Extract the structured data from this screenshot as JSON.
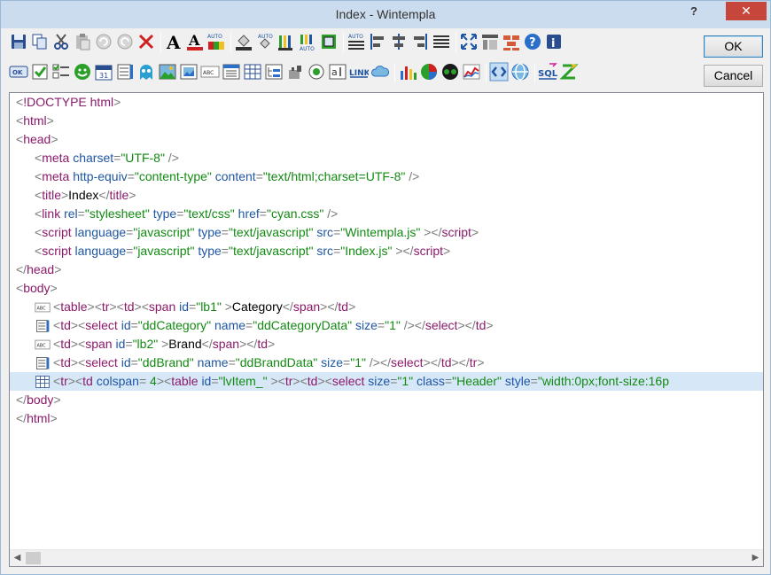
{
  "window": {
    "title": "Index  -  Wintempla",
    "help_glyph": "?",
    "close_glyph": "✕"
  },
  "buttons": {
    "ok": "OK",
    "cancel": "Cancel"
  },
  "toolbar": {
    "row1": [
      {
        "name": "save-icon",
        "glyph": "save"
      },
      {
        "name": "copy-icon",
        "glyph": "copy"
      },
      {
        "name": "cut-icon",
        "glyph": "cut"
      },
      {
        "name": "paste-icon",
        "glyph": "paste"
      },
      {
        "name": "undo-icon",
        "glyph": "undo"
      },
      {
        "name": "redo-icon",
        "glyph": "redo"
      },
      {
        "name": "delete-icon",
        "glyph": "delete"
      },
      {
        "name": "sep"
      },
      {
        "name": "font-icon",
        "glyph": "font"
      },
      {
        "name": "font-color-icon",
        "glyph": "fontcolor"
      },
      {
        "name": "auto-color-icon",
        "glyph": "autocolor"
      },
      {
        "name": "sep"
      },
      {
        "name": "fill-bucket-icon",
        "glyph": "bucket"
      },
      {
        "name": "auto-fill-icon",
        "glyph": "autobucket"
      },
      {
        "name": "pencils-icon",
        "glyph": "pencils"
      },
      {
        "name": "auto-pencils-icon",
        "glyph": "autopencils"
      },
      {
        "name": "border-icon",
        "glyph": "border"
      },
      {
        "name": "sep"
      },
      {
        "name": "auto-align-icon",
        "glyph": "autoalign"
      },
      {
        "name": "align-left-icon",
        "glyph": "alignleft"
      },
      {
        "name": "align-center-icon",
        "glyph": "aligncenter"
      },
      {
        "name": "align-right-icon",
        "glyph": "alignright"
      },
      {
        "name": "justify-icon",
        "glyph": "justify"
      },
      {
        "name": "sep"
      },
      {
        "name": "fullscreen-icon",
        "glyph": "fullscreen"
      },
      {
        "name": "layout-icon",
        "glyph": "layout"
      },
      {
        "name": "bricks-icon",
        "glyph": "bricks"
      },
      {
        "name": "help-icon",
        "glyph": "help"
      },
      {
        "name": "info-icon",
        "glyph": "info"
      }
    ],
    "row2": [
      {
        "name": "ok-control-icon",
        "glyph": "okbtn"
      },
      {
        "name": "checkbox-icon",
        "glyph": "checkbox"
      },
      {
        "name": "checklist-icon",
        "glyph": "checklist"
      },
      {
        "name": "smiley-icon",
        "glyph": "smiley"
      },
      {
        "name": "calendar-icon",
        "glyph": "calendar"
      },
      {
        "name": "listbox-icon",
        "glyph": "listbox"
      },
      {
        "name": "ghost-icon",
        "glyph": "ghost"
      },
      {
        "name": "picture-icon",
        "glyph": "picture"
      },
      {
        "name": "image-frame-icon",
        "glyph": "imageframe"
      },
      {
        "name": "label-icon",
        "glyph": "label"
      },
      {
        "name": "listview-icon",
        "glyph": "listview"
      },
      {
        "name": "table-icon",
        "glyph": "table"
      },
      {
        "name": "tree-icon",
        "glyph": "tree"
      },
      {
        "name": "plugin-icon",
        "glyph": "plugin"
      },
      {
        "name": "radio-icon",
        "glyph": "radio"
      },
      {
        "name": "textbox-icon",
        "glyph": "textbox"
      },
      {
        "name": "link-icon",
        "glyph": "link",
        "text": "LINK"
      },
      {
        "name": "cloud-icon",
        "glyph": "cloud"
      },
      {
        "name": "sep"
      },
      {
        "name": "bar-chart-icon",
        "glyph": "barchart"
      },
      {
        "name": "pie-chart-icon",
        "glyph": "piechart"
      },
      {
        "name": "eyes-icon",
        "glyph": "eyes"
      },
      {
        "name": "line-chart-icon",
        "glyph": "linechart"
      },
      {
        "name": "sep"
      },
      {
        "name": "code-view-icon",
        "glyph": "code"
      },
      {
        "name": "browser-view-icon",
        "glyph": "browser"
      },
      {
        "name": "sep"
      },
      {
        "name": "sql-icon",
        "glyph": "sql",
        "text": "SQL"
      },
      {
        "name": "sort-icon",
        "glyph": "sort"
      }
    ]
  },
  "editor": {
    "lines": [
      {
        "indent": 0,
        "icon": null,
        "tokens": [
          [
            "br",
            "<"
          ],
          [
            "tag",
            "!DOCTYPE html"
          ],
          [
            "br",
            ">"
          ]
        ]
      },
      {
        "indent": 0,
        "icon": null,
        "tokens": [
          [
            "br",
            "<"
          ],
          [
            "tag",
            "html"
          ],
          [
            "br",
            ">"
          ]
        ]
      },
      {
        "indent": 0,
        "icon": null,
        "tokens": [
          [
            "br",
            "<"
          ],
          [
            "tag",
            "head"
          ],
          [
            "br",
            ">"
          ]
        ]
      },
      {
        "indent": 1,
        "icon": null,
        "tokens": [
          [
            "br",
            "<"
          ],
          [
            "tag",
            "meta "
          ],
          [
            "attr",
            "charset"
          ],
          [
            "br",
            "="
          ],
          [
            "val",
            "\"UTF-8\""
          ],
          [
            "br",
            " />"
          ]
        ]
      },
      {
        "indent": 1,
        "icon": null,
        "tokens": [
          [
            "br",
            "<"
          ],
          [
            "tag",
            "meta "
          ],
          [
            "attr",
            "http-equiv"
          ],
          [
            "br",
            "="
          ],
          [
            "val",
            "\"content-type\""
          ],
          [
            "br",
            "  "
          ],
          [
            "attr",
            "content"
          ],
          [
            "br",
            "="
          ],
          [
            "val",
            "\"text/html;charset=UTF-8\""
          ],
          [
            "br",
            " />"
          ]
        ]
      },
      {
        "indent": 1,
        "icon": null,
        "tokens": [
          [
            "br",
            "<"
          ],
          [
            "tag",
            "title"
          ],
          [
            "br",
            ">"
          ],
          [
            "txt",
            "Index"
          ],
          [
            "br",
            "</"
          ],
          [
            "tag",
            "title"
          ],
          [
            "br",
            ">"
          ]
        ]
      },
      {
        "indent": 1,
        "icon": null,
        "tokens": [
          [
            "br",
            "<"
          ],
          [
            "tag",
            "link "
          ],
          [
            "attr",
            "rel"
          ],
          [
            "br",
            "="
          ],
          [
            "val",
            "\"stylesheet\""
          ],
          [
            "br",
            "  "
          ],
          [
            "attr",
            "type"
          ],
          [
            "br",
            "="
          ],
          [
            "val",
            "\"text/css\""
          ],
          [
            "br",
            "  "
          ],
          [
            "attr",
            "href"
          ],
          [
            "br",
            "="
          ],
          [
            "val",
            "\"cyan.css\""
          ],
          [
            "br",
            " />"
          ]
        ]
      },
      {
        "indent": 1,
        "icon": null,
        "tokens": [
          [
            "br",
            "<"
          ],
          [
            "tag",
            "script "
          ],
          [
            "attr",
            "language"
          ],
          [
            "br",
            "="
          ],
          [
            "val",
            "\"javascript\""
          ],
          [
            "br",
            "  "
          ],
          [
            "attr",
            "type"
          ],
          [
            "br",
            "="
          ],
          [
            "val",
            "\"text/javascript\""
          ],
          [
            "br",
            "  "
          ],
          [
            "attr",
            "src"
          ],
          [
            "br",
            "="
          ],
          [
            "val",
            "\"Wintempla.js\""
          ],
          [
            "br",
            " ></"
          ],
          [
            "tag",
            "script"
          ],
          [
            "br",
            ">"
          ]
        ]
      },
      {
        "indent": 1,
        "icon": null,
        "tokens": [
          [
            "br",
            "<"
          ],
          [
            "tag",
            "script "
          ],
          [
            "attr",
            "language"
          ],
          [
            "br",
            "="
          ],
          [
            "val",
            "\"javascript\""
          ],
          [
            "br",
            "  "
          ],
          [
            "attr",
            "type"
          ],
          [
            "br",
            "="
          ],
          [
            "val",
            "\"text/javascript\""
          ],
          [
            "br",
            "  "
          ],
          [
            "attr",
            "src"
          ],
          [
            "br",
            "="
          ],
          [
            "val",
            "\"Index.js\""
          ],
          [
            "br",
            " ></"
          ],
          [
            "tag",
            "script"
          ],
          [
            "br",
            ">"
          ]
        ]
      },
      {
        "indent": 0,
        "icon": null,
        "tokens": [
          [
            "br",
            "</"
          ],
          [
            "tag",
            "head"
          ],
          [
            "br",
            ">"
          ]
        ]
      },
      {
        "indent": 0,
        "icon": null,
        "tokens": [
          [
            "br",
            "<"
          ],
          [
            "tag",
            "body"
          ],
          [
            "br",
            ">"
          ]
        ]
      },
      {
        "indent": 1,
        "icon": "label-line-icon",
        "tokens": [
          [
            "br",
            "<"
          ],
          [
            "tag",
            "table"
          ],
          [
            "br",
            "><"
          ],
          [
            "tag",
            "tr"
          ],
          [
            "br",
            "><"
          ],
          [
            "tag",
            "td"
          ],
          [
            "br",
            "><"
          ],
          [
            "tag",
            "span "
          ],
          [
            "attr",
            "id"
          ],
          [
            "br",
            "="
          ],
          [
            "val",
            "\"lb1\""
          ],
          [
            "br",
            " >"
          ],
          [
            "txt",
            "Category"
          ],
          [
            "br",
            "</"
          ],
          [
            "tag",
            "span"
          ],
          [
            "br",
            "></"
          ],
          [
            "tag",
            "td"
          ],
          [
            "br",
            ">"
          ]
        ]
      },
      {
        "indent": 1,
        "icon": "listbox-line-icon",
        "tokens": [
          [
            "br",
            "<"
          ],
          [
            "tag",
            "td"
          ],
          [
            "br",
            "><"
          ],
          [
            "tag",
            "select "
          ],
          [
            "attr",
            "id"
          ],
          [
            "br",
            "="
          ],
          [
            "val",
            "\"ddCategory\""
          ],
          [
            "br",
            "  "
          ],
          [
            "attr",
            "name"
          ],
          [
            "br",
            "="
          ],
          [
            "val",
            "\"ddCategoryData\""
          ],
          [
            "br",
            "  "
          ],
          [
            "attr",
            "size"
          ],
          [
            "br",
            "="
          ],
          [
            "val",
            "\"1\""
          ],
          [
            "br",
            " /></"
          ],
          [
            "tag",
            "select"
          ],
          [
            "br",
            "></"
          ],
          [
            "tag",
            "td"
          ],
          [
            "br",
            ">"
          ]
        ]
      },
      {
        "indent": 1,
        "icon": "label-line-icon",
        "tokens": [
          [
            "br",
            "<"
          ],
          [
            "tag",
            "td"
          ],
          [
            "br",
            "><"
          ],
          [
            "tag",
            "span "
          ],
          [
            "attr",
            "id"
          ],
          [
            "br",
            "="
          ],
          [
            "val",
            "\"lb2\""
          ],
          [
            "br",
            " >"
          ],
          [
            "txt",
            "Brand"
          ],
          [
            "br",
            "</"
          ],
          [
            "tag",
            "span"
          ],
          [
            "br",
            "></"
          ],
          [
            "tag",
            "td"
          ],
          [
            "br",
            ">"
          ]
        ]
      },
      {
        "indent": 1,
        "icon": "listbox-line-icon",
        "tokens": [
          [
            "br",
            "<"
          ],
          [
            "tag",
            "td"
          ],
          [
            "br",
            "><"
          ],
          [
            "tag",
            "select "
          ],
          [
            "attr",
            "id"
          ],
          [
            "br",
            "="
          ],
          [
            "val",
            "\"ddBrand\""
          ],
          [
            "br",
            "  "
          ],
          [
            "attr",
            "name"
          ],
          [
            "br",
            "="
          ],
          [
            "val",
            "\"ddBrandData\""
          ],
          [
            "br",
            "  "
          ],
          [
            "attr",
            "size"
          ],
          [
            "br",
            "="
          ],
          [
            "val",
            "\"1\""
          ],
          [
            "br",
            " /></"
          ],
          [
            "tag",
            "select"
          ],
          [
            "br",
            "></"
          ],
          [
            "tag",
            "td"
          ],
          [
            "br",
            "></"
          ],
          [
            "tag",
            "tr"
          ],
          [
            "br",
            ">"
          ]
        ]
      },
      {
        "indent": 1,
        "icon": "listview-line-icon",
        "selected": true,
        "tokens": [
          [
            "br",
            "<"
          ],
          [
            "tag",
            "tr"
          ],
          [
            "br",
            "><"
          ],
          [
            "tag",
            "td "
          ],
          [
            "attr",
            "colspan"
          ],
          [
            "br",
            "= "
          ],
          [
            "val",
            "4"
          ],
          [
            "br",
            "><"
          ],
          [
            "tag",
            "table "
          ],
          [
            "attr",
            "id"
          ],
          [
            "br",
            "="
          ],
          [
            "val",
            "\"lvItem_\""
          ],
          [
            "br",
            " ><"
          ],
          [
            "tag",
            "tr"
          ],
          [
            "br",
            "><"
          ],
          [
            "tag",
            "td"
          ],
          [
            "br",
            "><"
          ],
          [
            "tag",
            "select "
          ],
          [
            "attr",
            "size"
          ],
          [
            "br",
            "="
          ],
          [
            "val",
            "\"1\""
          ],
          [
            "br",
            "  "
          ],
          [
            "attr",
            "class"
          ],
          [
            "br",
            "="
          ],
          [
            "val",
            "\"Header\""
          ],
          [
            "br",
            "  "
          ],
          [
            "attr",
            "style"
          ],
          [
            "br",
            "="
          ],
          [
            "val",
            "\"width:0px;font-size:16p"
          ]
        ]
      },
      {
        "indent": 0,
        "icon": null,
        "tokens": [
          [
            "br",
            "</"
          ],
          [
            "tag",
            "body"
          ],
          [
            "br",
            ">"
          ]
        ]
      },
      {
        "indent": 0,
        "icon": null,
        "tokens": [
          [
            "br",
            "</"
          ],
          [
            "tag",
            "html"
          ],
          [
            "br",
            ">"
          ]
        ]
      }
    ]
  },
  "colors": {
    "tag": "#8b1a6b",
    "attr": "#1f56a3",
    "value": "#128a12",
    "bracket": "#7a7a7a",
    "selection": "#d6e7f7"
  }
}
